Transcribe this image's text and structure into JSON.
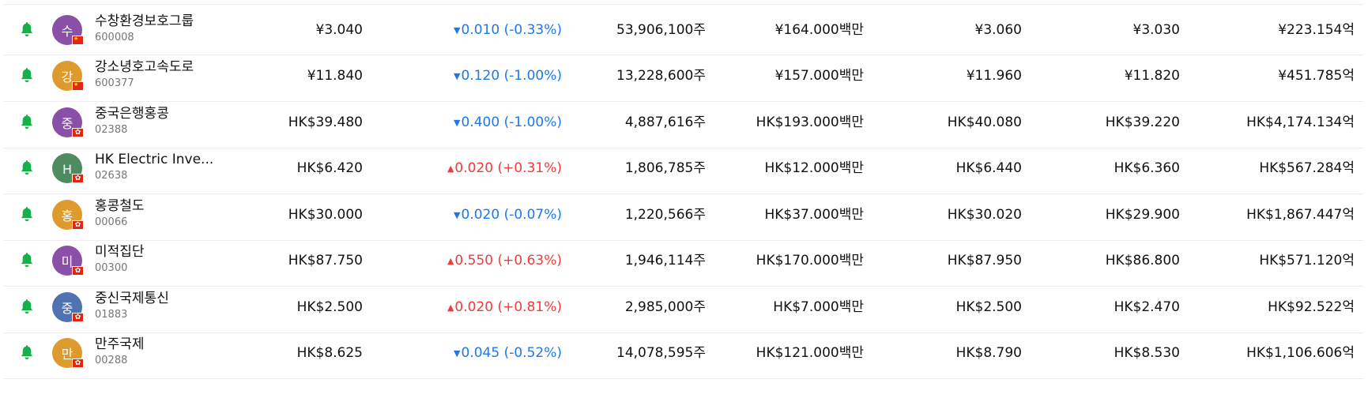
{
  "colors": {
    "bell": "#16b04a",
    "down": "#1e78ea",
    "up": "#ee3c3c",
    "purple_avatar": "#8a4fa6",
    "orange_avatar": "#dc9a2f",
    "green_avatar": "#4f8a61",
    "blue_avatar": "#4f73b1"
  },
  "icons": {
    "alert": "bell-icon",
    "flag_cn": "china-flag-icon",
    "flag_hk": "hong-kong-flag-icon",
    "down": "triangle-down-icon",
    "up": "triangle-up-icon"
  },
  "rows": [
    {
      "initial": "수",
      "avatar_color": "#8a4fa6",
      "flag": "cn",
      "name": "수창환경보호그룹",
      "code": "600008",
      "price": "¥3.040",
      "direction": "down",
      "change": "0.010 (-0.33%)",
      "volume": "53,906,100주",
      "turnover": "¥164.000백만",
      "high": "¥3.060",
      "low": "¥3.030",
      "market_cap": "¥223.154억"
    },
    {
      "initial": "강",
      "avatar_color": "#dc9a2f",
      "flag": "cn",
      "name": "강소녕호고속도로",
      "code": "600377",
      "price": "¥11.840",
      "direction": "down",
      "change": "0.120 (-1.00%)",
      "volume": "13,228,600주",
      "turnover": "¥157.000백만",
      "high": "¥11.960",
      "low": "¥11.820",
      "market_cap": "¥451.785억"
    },
    {
      "initial": "중",
      "avatar_color": "#8a4fa6",
      "flag": "hk",
      "name": "중국은행홍콩",
      "code": "02388",
      "price": "HK$39.480",
      "direction": "down",
      "change": "0.400 (-1.00%)",
      "volume": "4,887,616주",
      "turnover": "HK$193.000백만",
      "high": "HK$40.080",
      "low": "HK$39.220",
      "market_cap": "HK$4,174.134억"
    },
    {
      "initial": "H",
      "avatar_color": "#4f8a61",
      "flag": "hk",
      "name": "HK Electric Inve...",
      "code": "02638",
      "price": "HK$6.420",
      "direction": "up",
      "change": "0.020 (+0.31%)",
      "volume": "1,806,785주",
      "turnover": "HK$12.000백만",
      "high": "HK$6.440",
      "low": "HK$6.360",
      "market_cap": "HK$567.284억"
    },
    {
      "initial": "홍",
      "avatar_color": "#dc9a2f",
      "flag": "hk",
      "name": "홍콩철도",
      "code": "00066",
      "price": "HK$30.000",
      "direction": "down",
      "change": "0.020 (-0.07%)",
      "volume": "1,220,566주",
      "turnover": "HK$37.000백만",
      "high": "HK$30.020",
      "low": "HK$29.900",
      "market_cap": "HK$1,867.447억"
    },
    {
      "initial": "미",
      "avatar_color": "#8a4fa6",
      "flag": "hk",
      "name": "미적집단",
      "code": "00300",
      "price": "HK$87.750",
      "direction": "up",
      "change": "0.550 (+0.63%)",
      "volume": "1,946,114주",
      "turnover": "HK$170.000백만",
      "high": "HK$87.950",
      "low": "HK$86.800",
      "market_cap": "HK$571.120억"
    },
    {
      "initial": "중",
      "avatar_color": "#4f73b1",
      "flag": "hk",
      "name": "중신국제통신",
      "code": "01883",
      "price": "HK$2.500",
      "direction": "up",
      "change": "0.020 (+0.81%)",
      "volume": "2,985,000주",
      "turnover": "HK$7.000백만",
      "high": "HK$2.500",
      "low": "HK$2.470",
      "market_cap": "HK$92.522억"
    },
    {
      "initial": "만",
      "avatar_color": "#dc9a2f",
      "flag": "hk",
      "name": "만주국제",
      "code": "00288",
      "price": "HK$8.625",
      "direction": "down",
      "change": "0.045 (-0.52%)",
      "volume": "14,078,595주",
      "turnover": "HK$121.000백만",
      "high": "HK$8.790",
      "low": "HK$8.530",
      "market_cap": "HK$1,106.606억"
    }
  ]
}
